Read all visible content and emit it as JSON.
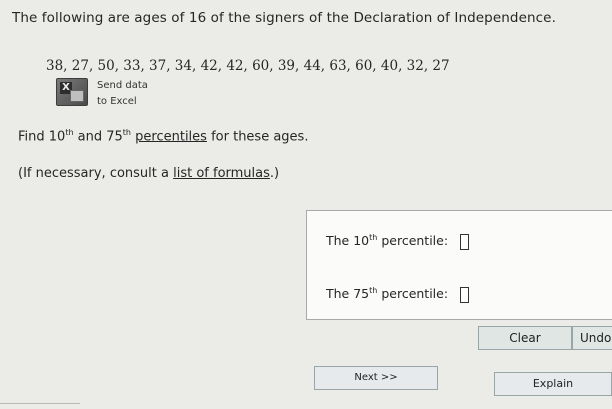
{
  "question": {
    "title": "The following are ages of 16 of the signers of the Declaration of Independence.",
    "ages_text": "38, 27, 50, 33, 37, 34, 42, 42, 60, 39, 44, 63, 60, 40, 32, 27",
    "send_data_line1": "Send data",
    "send_data_line2": "to Excel",
    "find_prefix": "Find 10",
    "find_sup1": "th",
    "find_mid": " and 75",
    "find_sup2": "th",
    "find_link": "percentiles",
    "find_suffix": " for these ages.",
    "note_prefix": "(If necessary, consult a ",
    "note_link": "list of formulas",
    "note_suffix": ".)"
  },
  "answers": {
    "p10_prefix": "The 10",
    "p10_sup": "th",
    "p10_suffix": " percentile:",
    "p10_value": "",
    "p75_prefix": "The 75",
    "p75_sup": "th",
    "p75_suffix": " percentile:",
    "p75_value": ""
  },
  "buttons": {
    "clear": "Clear",
    "undo": "Undo",
    "next": "Next >>",
    "explain": "Explain"
  },
  "icons": [
    "excel-icon"
  ]
}
